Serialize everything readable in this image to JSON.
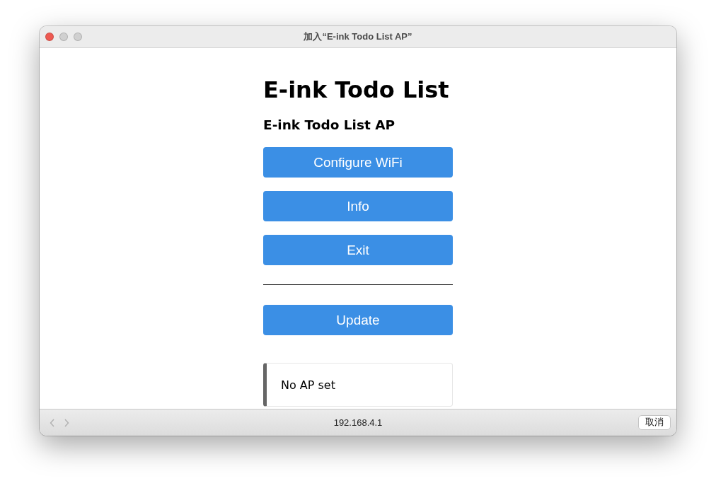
{
  "window": {
    "title": "加入“E-ink Todo List AP”"
  },
  "page": {
    "heading": "E-ink Todo List",
    "subheading": "E-ink Todo List AP",
    "buttons": [
      "Configure WiFi",
      "Info",
      "Exit"
    ],
    "update_button": "Update",
    "message": "No AP set"
  },
  "bottom_bar": {
    "address": "192.168.4.1",
    "cancel_button": "取消"
  }
}
